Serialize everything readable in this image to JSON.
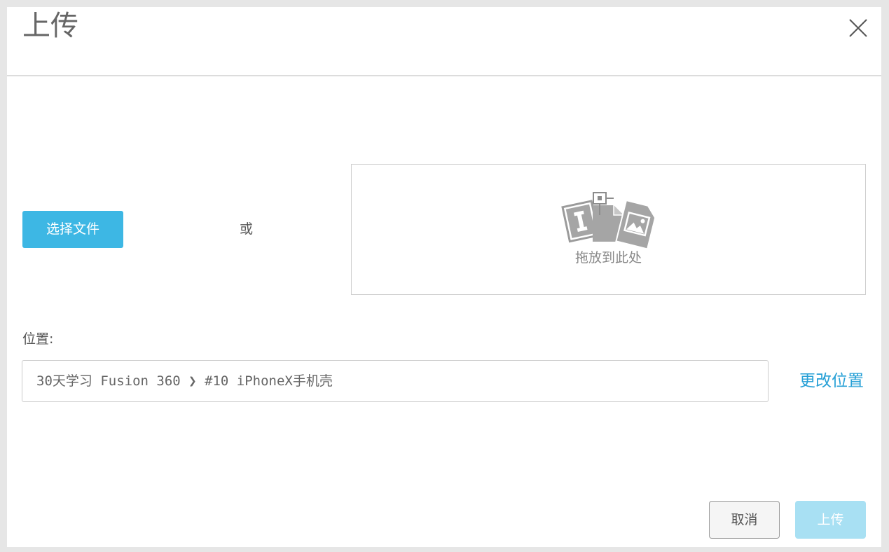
{
  "dialog": {
    "title": "上传",
    "close_icon": "close-icon"
  },
  "upload": {
    "choose_file_label": "选择文件",
    "or_label": "或",
    "drop_text": "拖放到此处",
    "drop_icon": "drag-drop-files-icon"
  },
  "location": {
    "label": "位置:",
    "path": "30天学习 Fusion 360 ❯ #10 iPhoneX手机壳",
    "change_label": "更改位置"
  },
  "footer": {
    "cancel_label": "取消",
    "upload_label": "上传",
    "upload_enabled": false
  },
  "colors": {
    "accent": "#3db7e4",
    "link": "#27a0d6",
    "disabled_button": "#a8e0f3"
  }
}
